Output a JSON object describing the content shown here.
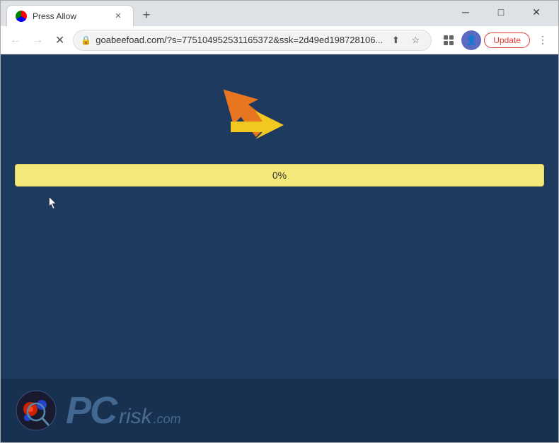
{
  "browser": {
    "title": "Press Allow",
    "tab_label": "Press Allow",
    "url": "goabeefoad.com/?s=775104952531165372&ssk=2d49ed198728106...",
    "update_button": "Update",
    "new_tab_icon": "+",
    "progress_text": "0%"
  },
  "window_controls": {
    "minimize": "─",
    "maximize": "□",
    "close": "✕"
  },
  "nav": {
    "back": "←",
    "forward": "→",
    "refresh": "✕"
  },
  "logo": {
    "text": "PC",
    "risk": "risk",
    "dot_com": ".com"
  },
  "arrows": {
    "orange_label": "orange-arrow-up-right",
    "yellow_label": "yellow-arrow-left"
  },
  "colors": {
    "page_bg": "#1e3a5f",
    "progress_bg": "#f5e87a",
    "orange_arrow": "#e87520",
    "yellow_arrow": "#f0c820",
    "update_red": "#e53935"
  }
}
